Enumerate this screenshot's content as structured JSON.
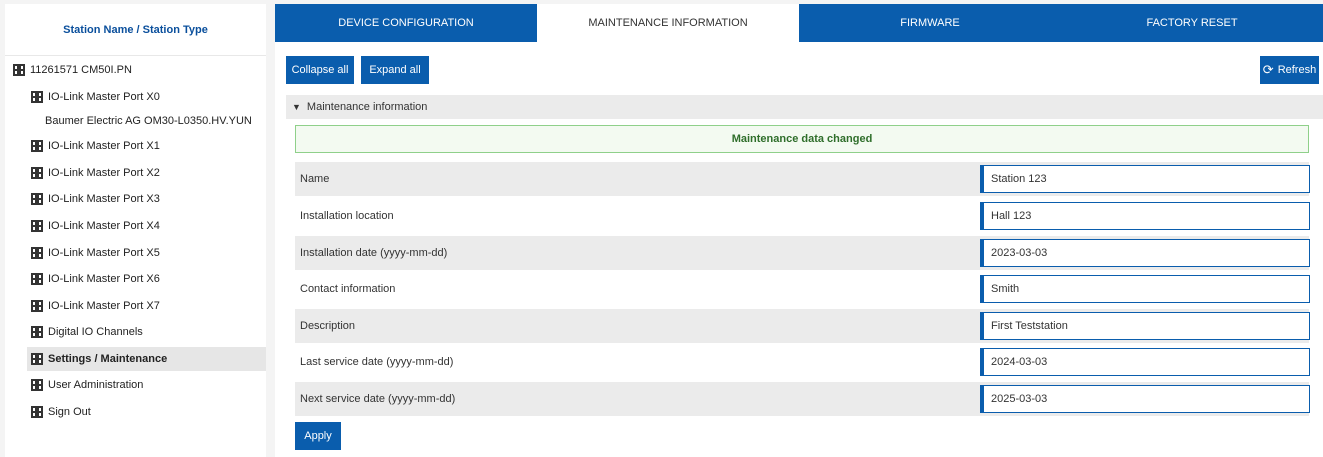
{
  "sidebar": {
    "header": "Station Name / Station Type",
    "items": [
      {
        "label": "11261571 CM50I.PN"
      },
      {
        "label": "IO-Link Master Port X0"
      },
      {
        "label": "Baumer Electric AG OM30-L0350.HV.YUN"
      },
      {
        "label": "IO-Link Master Port X1"
      },
      {
        "label": "IO-Link Master Port X2"
      },
      {
        "label": "IO-Link Master Port X3"
      },
      {
        "label": "IO-Link Master Port X4"
      },
      {
        "label": "IO-Link Master Port X5"
      },
      {
        "label": "IO-Link Master Port X6"
      },
      {
        "label": "IO-Link Master Port X7"
      },
      {
        "label": "Digital IO Channels"
      },
      {
        "label": "Settings / Maintenance"
      },
      {
        "label": "User Administration"
      },
      {
        "label": "Sign Out"
      }
    ]
  },
  "tabs": [
    {
      "label": "DEVICE CONFIGURATION"
    },
    {
      "label": "MAINTENANCE INFORMATION"
    },
    {
      "label": "FIRMWARE"
    },
    {
      "label": "FACTORY RESET"
    }
  ],
  "toolbar": {
    "collapse_label": "Collapse all",
    "expand_label": "Expand all",
    "refresh_label": "Refresh"
  },
  "section": {
    "title": "Maintenance information"
  },
  "alert": {
    "message": "Maintenance data changed"
  },
  "fields": [
    {
      "label": "Name",
      "value": "Station 123"
    },
    {
      "label": "Installation location",
      "value": "Hall 123"
    },
    {
      "label": "Installation date (yyyy-mm-dd)",
      "value": "2023-03-03"
    },
    {
      "label": "Contact information",
      "value": "Smith"
    },
    {
      "label": "Description",
      "value": "First Teststation"
    },
    {
      "label": "Last service date (yyyy-mm-dd)",
      "value": "2024-03-03"
    },
    {
      "label": "Next service date (yyyy-mm-dd)",
      "value": "2025-03-03"
    }
  ],
  "apply_label": "Apply"
}
